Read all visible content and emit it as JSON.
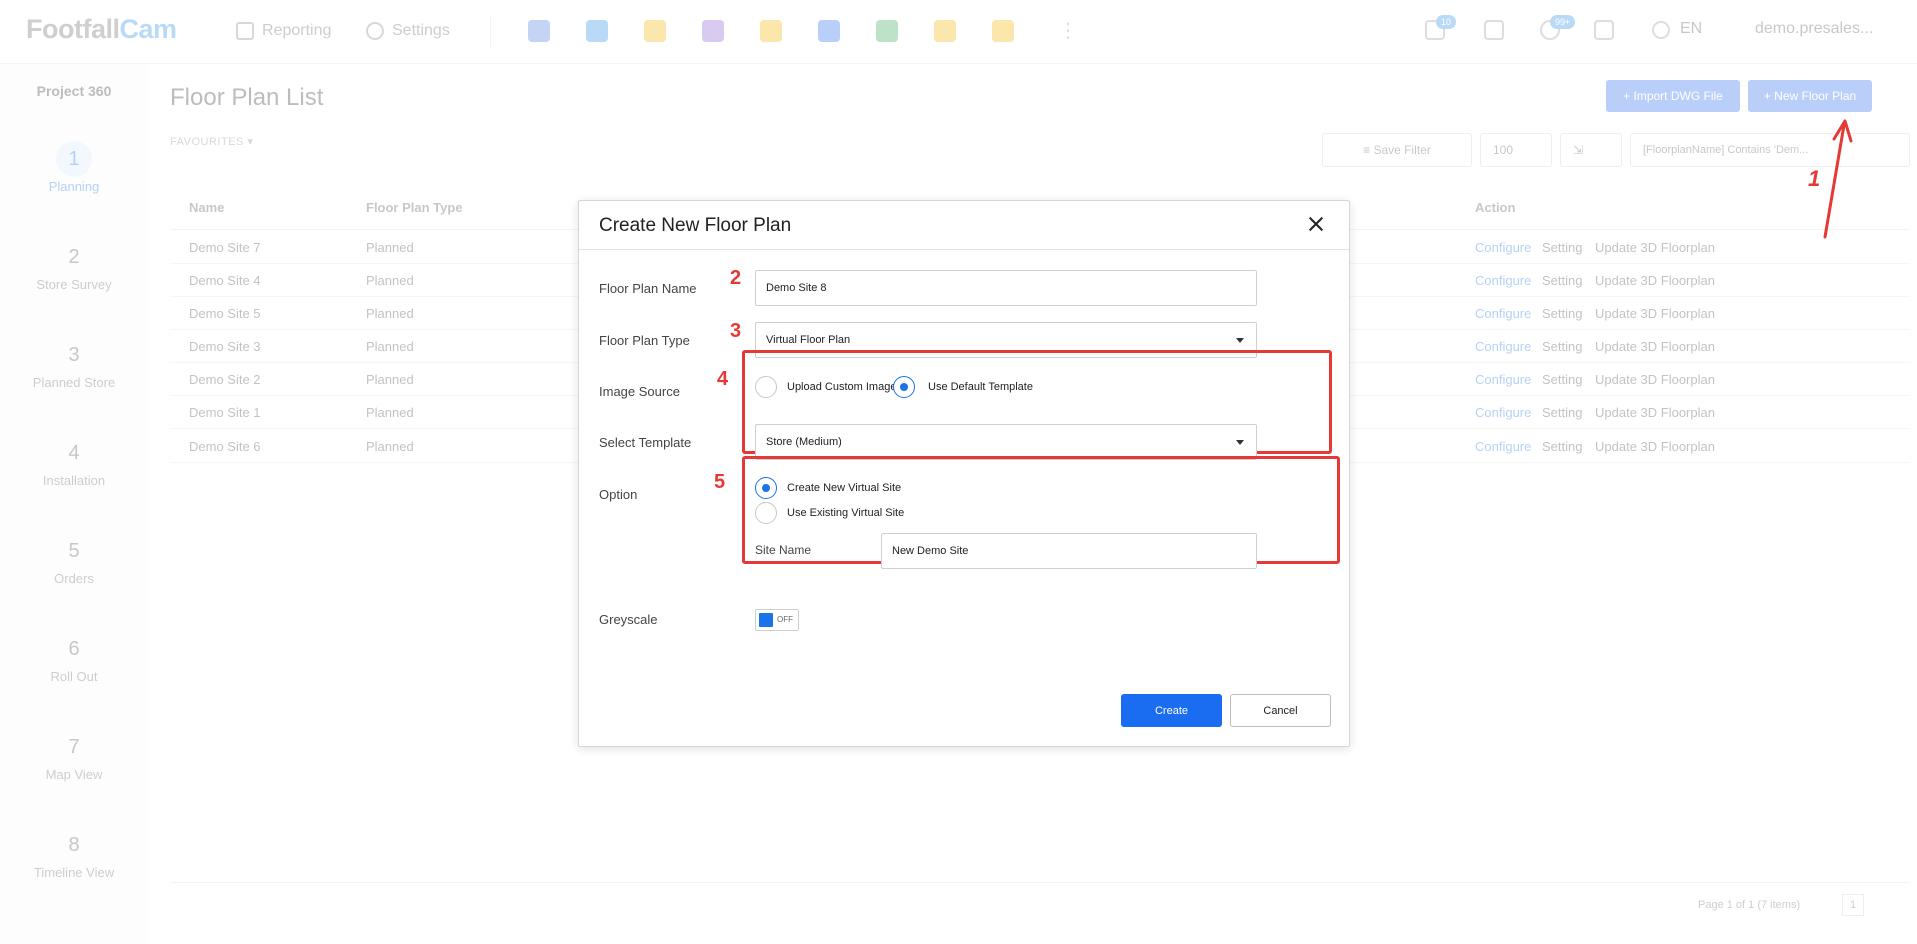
{
  "topbar": {
    "logo_part1": "Footfall",
    "logo_part2": "Cam",
    "nav_reporting": "Reporting",
    "nav_settings": "Settings",
    "more_glyph": "⋮",
    "badge_messages": "10",
    "badge_notifications": "99+",
    "language": "EN",
    "user": "demo.presales...",
    "app_colors": [
      "#4a7de0",
      "#2a8fe8",
      "#f5b400",
      "#8a5cd6",
      "#f5b400",
      "#2a6cf0",
      "#34a853",
      "#f5b400",
      "#f5b400"
    ]
  },
  "sidebar": {
    "project": "Project 360",
    "steps": [
      {
        "num": "1",
        "label": "Planning"
      },
      {
        "num": "2",
        "label": "Store Survey"
      },
      {
        "num": "3",
        "label": "Planned Store"
      },
      {
        "num": "4",
        "label": "Installation"
      },
      {
        "num": "5",
        "label": "Orders"
      },
      {
        "num": "6",
        "label": "Roll Out"
      },
      {
        "num": "7",
        "label": "Map View"
      },
      {
        "num": "8",
        "label": "Timeline View"
      }
    ]
  },
  "main": {
    "title": "Floor Plan List",
    "favourites": "FAVOURITES ▾",
    "import_button": "+ Import DWG File",
    "new_button": "+ New Floor Plan",
    "save_filter": "Save Filter",
    "page_size": "100",
    "filter_text": "[FloorplanName] Contains 'Dem...",
    "columns": {
      "name": "Name",
      "type": "Floor Plan Type",
      "action": "Action"
    },
    "rows": [
      {
        "name": "Demo Site 7",
        "type": "Planned"
      },
      {
        "name": "Demo Site 4",
        "type": "Planned"
      },
      {
        "name": "Demo Site 5",
        "type": "Planned"
      },
      {
        "name": "Demo Site 3",
        "type": "Planned"
      },
      {
        "name": "Demo Site 2",
        "type": "Planned"
      },
      {
        "name": "Demo Site 1",
        "type": "Planned"
      },
      {
        "name": "Demo Site 6",
        "type": "Planned"
      }
    ],
    "actions": {
      "configure": "Configure",
      "setting": "Setting",
      "update3d": "Update 3D Floorplan"
    },
    "pager": "Page 1 of 1 (7 items)",
    "pager_current": "1"
  },
  "annotations": {
    "a1": "1",
    "a2": "2",
    "a3": "3",
    "a4": "4",
    "a5": "5",
    "color": "#e53935"
  },
  "modal": {
    "title": "Create New Floor Plan",
    "floor_plan_name_label": "Floor Plan Name",
    "floor_plan_name_value": "Demo Site 8",
    "floor_plan_type_label": "Floor Plan Type",
    "floor_plan_type_value": "Virtual Floor Plan",
    "image_source_label": "Image Source",
    "image_source_opt1": "Upload Custom Image",
    "image_source_opt2": "Use Default Template",
    "image_source_selected": "Use Default Template",
    "select_template_label": "Select Template",
    "select_template_value": "Store (Medium)",
    "option_label": "Option",
    "option_opt1": "Create New Virtual Site",
    "option_opt2": "Use Existing Virtual Site",
    "option_selected": "Create New Virtual Site",
    "site_name_label": "Site Name",
    "site_name_value": "New Demo Site",
    "greyscale_label": "Greyscale",
    "greyscale_state": "OFF",
    "create_button": "Create",
    "cancel_button": "Cancel"
  }
}
